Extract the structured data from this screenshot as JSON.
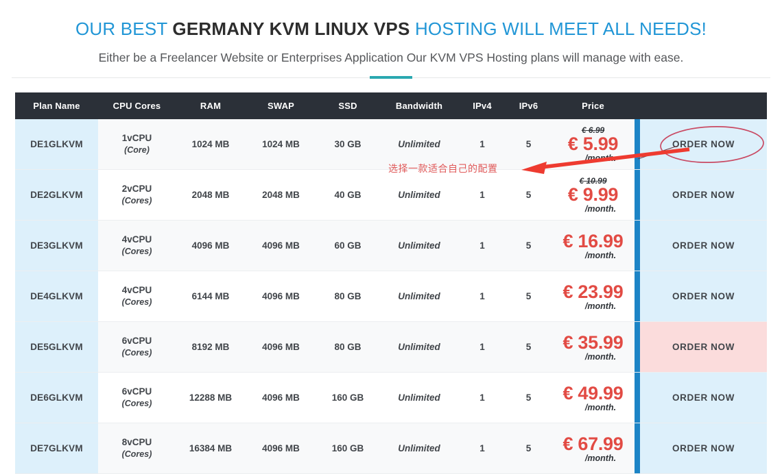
{
  "header": {
    "title_part1": "OUR BEST ",
    "title_strong": "GERMANY KVM LINUX VPS",
    "title_part2": " HOSTING WILL MEET ALL NEEDS!",
    "subtitle": "Either be a Freelancer Website or Enterprises Application Our KVM VPS Hosting plans will manage with ease.",
    "accent_color": "#2196d6",
    "underline_color": "#2aa8b0"
  },
  "table": {
    "columns": [
      "Plan Name",
      "CPU Cores",
      "RAM",
      "SWAP",
      "SSD",
      "Bandwidth",
      "IPv4",
      "IPv6",
      "Price"
    ],
    "action_label": "ORDER NOW",
    "header_bg": "#2b3038",
    "separator_color": "#1c84c6",
    "plan_col_bg": "#ddf0fb",
    "order_col_bg": "#ddf0fb",
    "order_hover_bg": "#fbdcdc",
    "price_color": "#e24b44",
    "order_text_color": "#2a89c6",
    "rows": [
      {
        "plan": "DE1GLKVM",
        "cpu_main": "1vCPU",
        "cpu_sub": "(Core)",
        "ram": "1024 MB",
        "swap": "1024 MB",
        "ssd": "30 GB",
        "bandwidth": "Unlimited",
        "ipv4": "1",
        "ipv6": "5",
        "price_old": "€ 6.99",
        "price_new": "€ 5.99",
        "price_per": "/month.",
        "action": "ORDER NOW",
        "hovered": false
      },
      {
        "plan": "DE2GLKVM",
        "cpu_main": "2vCPU",
        "cpu_sub": "(Cores)",
        "ram": "2048 MB",
        "swap": "2048 MB",
        "ssd": "40 GB",
        "bandwidth": "Unlimited",
        "ipv4": "1",
        "ipv6": "5",
        "price_old": "€ 10.99",
        "price_new": "€ 9.99",
        "price_per": "/month.",
        "action": "ORDER NOW",
        "hovered": false
      },
      {
        "plan": "DE3GLKVM",
        "cpu_main": "4vCPU",
        "cpu_sub": "(Cores)",
        "ram": "4096 MB",
        "swap": "4096 MB",
        "ssd": "60 GB",
        "bandwidth": "Unlimited",
        "ipv4": "1",
        "ipv6": "5",
        "price_old": "",
        "price_new": "€ 16.99",
        "price_per": "/month.",
        "action": "ORDER NOW",
        "hovered": false
      },
      {
        "plan": "DE4GLKVM",
        "cpu_main": "4vCPU",
        "cpu_sub": "(Cores)",
        "ram": "6144 MB",
        "swap": "4096 MB",
        "ssd": "80 GB",
        "bandwidth": "Unlimited",
        "ipv4": "1",
        "ipv6": "5",
        "price_old": "",
        "price_new": "€ 23.99",
        "price_per": "/month.",
        "action": "ORDER NOW",
        "hovered": false
      },
      {
        "plan": "DE5GLKVM",
        "cpu_main": "6vCPU",
        "cpu_sub": "(Cores)",
        "ram": "8192 MB",
        "swap": "4096 MB",
        "ssd": "80 GB",
        "bandwidth": "Unlimited",
        "ipv4": "1",
        "ipv6": "5",
        "price_old": "",
        "price_new": "€ 35.99",
        "price_per": "/month.",
        "action": "ORDER NOW",
        "hovered": true
      },
      {
        "plan": "DE6GLKVM",
        "cpu_main": "6vCPU",
        "cpu_sub": "(Cores)",
        "ram": "12288 MB",
        "swap": "4096 MB",
        "ssd": "160 GB",
        "bandwidth": "Unlimited",
        "ipv4": "1",
        "ipv6": "5",
        "price_old": "",
        "price_new": "€ 49.99",
        "price_per": "/month.",
        "action": "ORDER NOW",
        "hovered": false
      },
      {
        "plan": "DE7GLKVM",
        "cpu_main": "8vCPU",
        "cpu_sub": "(Cores)",
        "ram": "16384 MB",
        "swap": "4096 MB",
        "ssd": "160 GB",
        "bandwidth": "Unlimited",
        "ipv4": "1",
        "ipv6": "5",
        "price_old": "",
        "price_new": "€ 67.99",
        "price_per": "/month.",
        "action": "ORDER NOW",
        "hovered": false
      }
    ]
  },
  "annotations": {
    "note_text": "选择一款适合自己的配置",
    "note_color": "#e05a5a",
    "arrow_color": "#ee3b30",
    "ellipse_color": "#c94a63"
  }
}
